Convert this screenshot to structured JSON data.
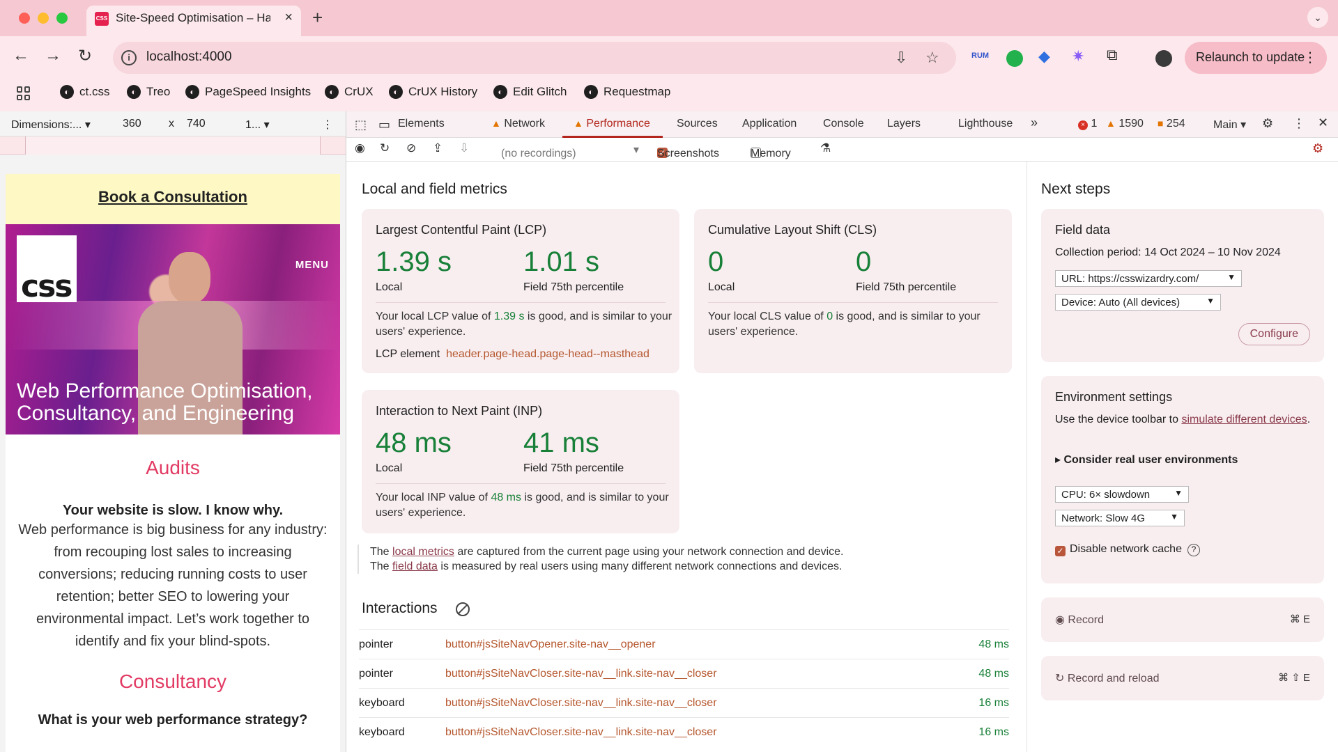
{
  "browser": {
    "tab_title": "Site-Speed Optimisation – Ha",
    "favicon_text": "CSS",
    "url": "localhost:4000",
    "relaunch_label": "Relaunch to update",
    "extension_rum_label": "RUM",
    "bookmarks": [
      "ct.css",
      "Treo",
      "PageSpeed Insights",
      "CrUX",
      "CrUX History",
      "Edit Glitch",
      "Requestmap"
    ]
  },
  "device_toolbar": {
    "preset": "Dimensions:...",
    "width": "360",
    "times": "x",
    "height": "740",
    "zoom": "1..."
  },
  "page": {
    "cta": "Book a Consultation",
    "logo_text": "css",
    "menu": "MENU",
    "hero_title": "Web Performance Optimisation, Consultancy, and Engineering",
    "audits_heading": "Audits",
    "audits_lead": "Your website is slow. I know why.",
    "audits_body": "Web performance is big business for any industry: from recouping lost sales to increasing conversions; reducing running costs to user retention; better SEO to lowering your environmental impact. Let’s work together to identify and fix your blind-spots.",
    "consultancy_heading": "Consultancy",
    "consultancy_q": "What is your web performance strategy?"
  },
  "devtools": {
    "tabs": [
      "Elements",
      "Network",
      "Performance",
      "Sources",
      "Application",
      "Console",
      "Layers",
      "Lighthouse"
    ],
    "active_tab": "Performance",
    "more": "»",
    "errors": "1",
    "warnings": "1590",
    "issues": "254",
    "target": "Main",
    "recordings_placeholder": "(no recordings)",
    "screenshots_label": "Screenshots",
    "memory_label": "Memory",
    "local_field_heading": "Local and field metrics",
    "lcp": {
      "title": "Largest Contentful Paint (LCP)",
      "local": "1.39 s",
      "local_label": "Local",
      "field": "1.01 s",
      "field_label": "Field 75th percentile",
      "desc_pre": "Your local LCP value of ",
      "desc_val": "1.39 s",
      "desc_post": " is good, and is similar to your users' experience.",
      "element_label": "LCP element",
      "element_selector": "header.page-head.page-head--masthead"
    },
    "cls": {
      "title": "Cumulative Layout Shift (CLS)",
      "local": "0",
      "local_label": "Local",
      "field": "0",
      "field_label": "Field 75th percentile",
      "desc_pre": "Your local CLS value of ",
      "desc_val": "0",
      "desc_post": " is good, and is similar to your users' experience."
    },
    "inp": {
      "title": "Interaction to Next Paint (INP)",
      "local": "48 ms",
      "local_label": "Local",
      "field": "41 ms",
      "field_label": "Field 75th percentile",
      "desc_pre": "Your local INP value of ",
      "desc_val": "48 ms",
      "desc_post": " is good, and is similar to your users' experience."
    },
    "note": {
      "l1_pre": "The ",
      "l1_link": "local metrics",
      "l1_post": " are captured from the current page using your network connection and device.",
      "l2_pre": "The ",
      "l2_link": "field data",
      "l2_post": " is measured by real users using many different network connections and devices."
    },
    "interactions_heading": "Interactions",
    "interactions": [
      {
        "type": "pointer",
        "target": "button#jsSiteNavOpener.site-nav__opener",
        "time": "48 ms"
      },
      {
        "type": "pointer",
        "target": "button#jsSiteNavCloser.site-nav__link.site-nav__closer",
        "time": "48 ms"
      },
      {
        "type": "keyboard",
        "target": "button#jsSiteNavCloser.site-nav__link.site-nav__closer",
        "time": "16 ms"
      },
      {
        "type": "keyboard",
        "target": "button#jsSiteNavCloser.site-nav__link.site-nav__closer",
        "time": "16 ms"
      }
    ],
    "next_steps": {
      "heading": "Next steps",
      "field_data_title": "Field data",
      "collection_period": "Collection period: 14 Oct 2024 – 10 Nov 2024",
      "url_select": "URL: https://csswizardry.com/",
      "device_select": "Device: Auto (All devices)",
      "configure": "Configure",
      "env_title": "Environment settings",
      "env_text_pre": "Use the device toolbar to ",
      "env_link": "simulate different devices",
      "env_text_post": ".",
      "consider": "Consider real user environments",
      "cpu_select": "CPU: 6× slowdown",
      "network_select": "Network: Slow 4G",
      "disable_cache": "Disable network cache",
      "record": "Record",
      "record_kbd": "⌘ E",
      "record_reload": "Record and reload",
      "record_reload_kbd": "⌘ ⇧ E"
    }
  }
}
